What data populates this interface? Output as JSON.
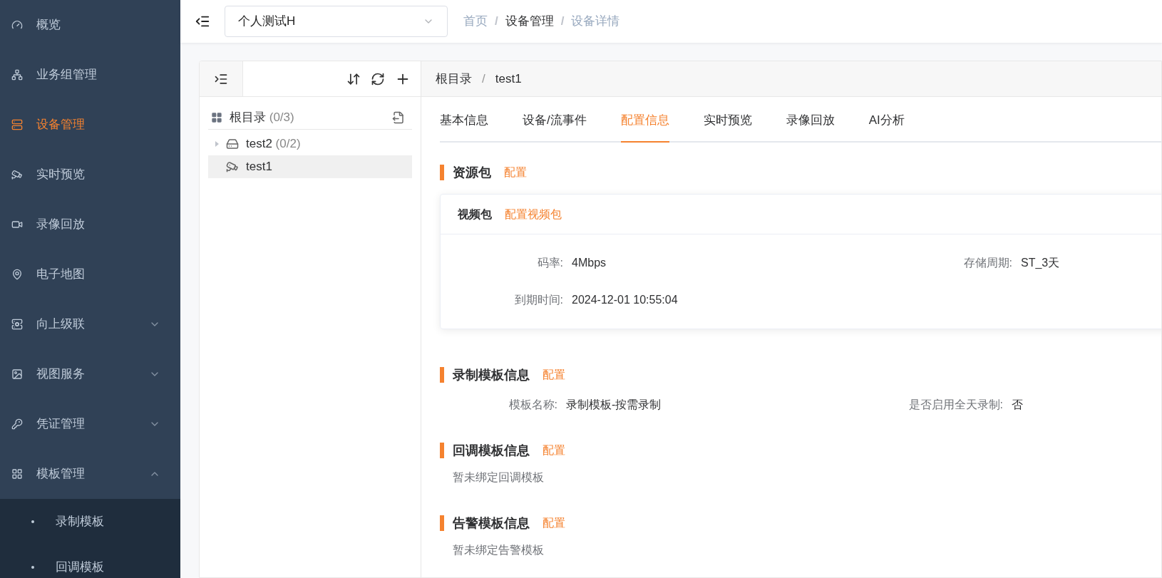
{
  "sidebar": {
    "items": [
      {
        "label": "概览",
        "selected": false
      },
      {
        "label": "业务组管理",
        "selected": false
      },
      {
        "label": "设备管理",
        "selected": true
      },
      {
        "label": "实时预览",
        "selected": false
      },
      {
        "label": "录像回放",
        "selected": false
      },
      {
        "label": "电子地图",
        "selected": false
      },
      {
        "label": "向上级联",
        "selected": false,
        "expanded": false
      },
      {
        "label": "视图服务",
        "selected": false,
        "expanded": false
      },
      {
        "label": "凭证管理",
        "selected": false,
        "expanded": false
      },
      {
        "label": "模板管理",
        "selected": false,
        "expanded": true,
        "children": [
          {
            "label": "录制模板",
            "selected": false
          },
          {
            "label": "回调模板",
            "selected": false
          }
        ]
      }
    ]
  },
  "header": {
    "project_select": {
      "value": "个人测试H"
    },
    "breadcrumb_separator": "/",
    "breadcrumb": [
      {
        "label": "首页",
        "muted": true
      },
      {
        "label": "设备管理",
        "muted": false
      },
      {
        "label": "设备详情",
        "muted": true
      }
    ]
  },
  "tree": {
    "root": {
      "label": "根目录",
      "count": "(0/3)",
      "children": [
        {
          "label": "test2",
          "count": "(0/2)",
          "kind": "nvr",
          "expanded": false,
          "selected": false
        },
        {
          "label": "test1",
          "kind": "camera",
          "selected": true
        }
      ]
    }
  },
  "detail": {
    "path_separator": "/",
    "path": [
      "根目录",
      "test1"
    ],
    "tabs": [
      {
        "label": "基本信息",
        "selected": false
      },
      {
        "label": "设备/流事件",
        "selected": false
      },
      {
        "label": "配置信息",
        "selected": true
      },
      {
        "label": "实时预览",
        "selected": false
      },
      {
        "label": "录像回放",
        "selected": false
      },
      {
        "label": "AI分析",
        "selected": false
      }
    ],
    "sections": [
      {
        "kind": "package",
        "title": "资源包",
        "action": "配置",
        "package": {
          "title": "视频包",
          "action": "配置视频包",
          "fields": [
            {
              "label": "码率:",
              "value": "4Mbps"
            },
            {
              "label": "存储周期:",
              "value": "ST_3天"
            },
            {
              "label": "到期时间:",
              "value": "2024-12-01 10:55:04"
            }
          ]
        }
      },
      {
        "kind": "fields",
        "title": "录制模板信息",
        "action": "配置",
        "fields": [
          {
            "label": "模板名称:",
            "value": "录制模板-按需录制"
          },
          {
            "label": "是否启用全天录制:",
            "value": "否"
          }
        ]
      },
      {
        "kind": "empty",
        "title": "回调模板信息",
        "action": "配置",
        "text": "暂未绑定回调模板"
      },
      {
        "kind": "empty",
        "title": "告警模板信息",
        "action": "配置",
        "text": "暂未绑定告警模板"
      }
    ]
  }
}
